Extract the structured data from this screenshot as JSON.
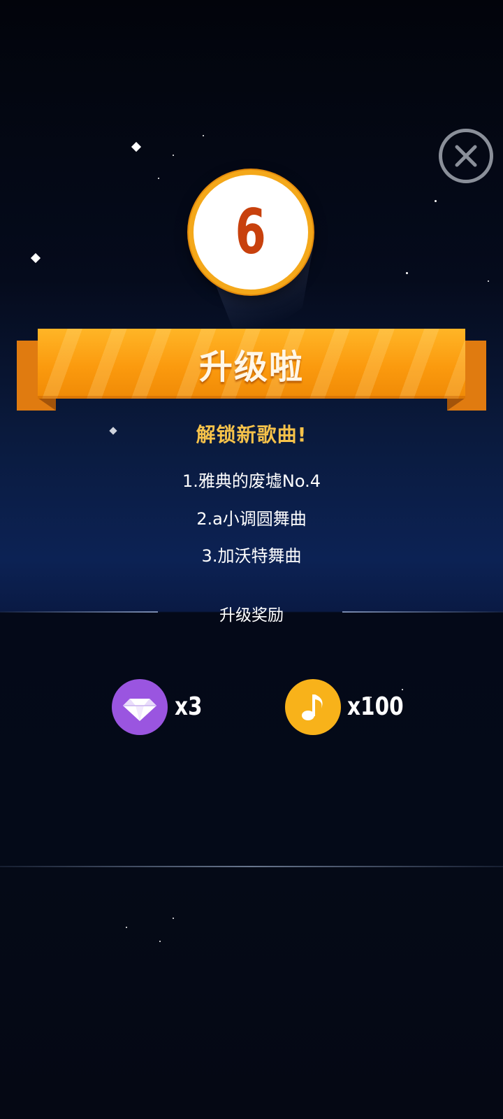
{
  "level": {
    "number": "6"
  },
  "banner": {
    "title": "升级啦"
  },
  "unlock": {
    "title": "解锁新歌曲!",
    "songs": [
      "1.雅典的废墟No.4",
      "2.a小调圆舞曲",
      "3.加沃特舞曲"
    ]
  },
  "rewards": {
    "title": "升级奖励",
    "items": [
      {
        "icon": "diamond-icon",
        "count": "x3",
        "color": "#9a55e0"
      },
      {
        "icon": "music-note-icon",
        "count": "x100",
        "color": "#f8b21a"
      }
    ]
  },
  "colors": {
    "accent_orange": "#fb9a0e",
    "level_number": "#c8410d",
    "unlock_title": "#f6c24a",
    "background": "#03050f"
  }
}
